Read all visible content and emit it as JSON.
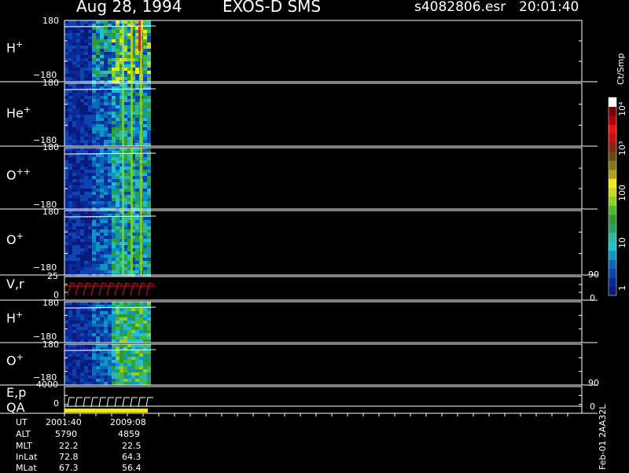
{
  "header": {
    "date": "Aug 28, 1994",
    "instrument": "EXOS-D SMS",
    "file": "s4082806.esr",
    "time": "20:01:40"
  },
  "panels": [
    {
      "key": "h_plus",
      "label": "H",
      "sup": "+",
      "ymax": "180",
      "ymin": "−180"
    },
    {
      "key": "he_plus",
      "label": "He",
      "sup": "+",
      "ymax": "180",
      "ymin": "−180"
    },
    {
      "key": "o_plus_plus",
      "label": "O",
      "sup": "++",
      "ymax": "180",
      "ymin": "−180"
    },
    {
      "key": "o_plus",
      "label": "O",
      "sup": "+",
      "ymax": "180",
      "ymin": "−180"
    },
    {
      "key": "vr",
      "label": "V,r",
      "sup": "",
      "ymax": "25",
      "ymin": "0",
      "rmax": "90",
      "rmin": "0"
    },
    {
      "key": "h_plus_2",
      "label": "H",
      "sup": "+",
      "ymax": "180",
      "ymin": "−180"
    },
    {
      "key": "o_plus_2",
      "label": "O",
      "sup": "+",
      "ymax": "180",
      "ymin": "−180"
    },
    {
      "key": "ep",
      "label": "E,p",
      "label2": "QA",
      "sup": "",
      "ymax": "4000",
      "ymin": "0",
      "rmax": "90",
      "rmin": "0"
    }
  ],
  "colorbar": {
    "unit": "Ct/Smp",
    "ticks": [
      "10⁴",
      "10³",
      "100",
      "10",
      "1"
    ],
    "colors": [
      "#0a1a7a",
      "#0b2a9a",
      "#0c45b0",
      "#0a6ab8",
      "#0d96c2",
      "#20c0d0",
      "#2fb8a0",
      "#2aa060",
      "#2f9a30",
      "#4fb82a",
      "#8ad22a",
      "#c8d820",
      "#f0e818",
      "#b0a020",
      "#807a1a",
      "#6a4a10",
      "#8a2410",
      "#c81010",
      "#f01010",
      "#b00000",
      "#7a0000",
      "#ffffff"
    ]
  },
  "footer": {
    "rows": [
      {
        "label": "UT",
        "v1": "2001:40",
        "v2": "2009:08"
      },
      {
        "label": "ALT",
        "v1": "5790",
        "v2": "4859"
      },
      {
        "label": "MLT",
        "v1": "22.2",
        "v2": "22.5"
      },
      {
        "label": "InLat",
        "v1": "72.8",
        "v2": "64.3"
      },
      {
        "label": "MLat",
        "v1": "67.3",
        "v2": "56.4"
      }
    ],
    "side_note": "Feb-01  2AA32L"
  },
  "chart_data": {
    "type": "heatmap",
    "title": "Aug 28, 1994   EXOS-D SMS",
    "x": [
      "2001:40",
      "2009:08"
    ],
    "series": [
      {
        "name": "H+",
        "ylim": [
          -180,
          180
        ]
      },
      {
        "name": "He+",
        "ylim": [
          -180,
          180
        ]
      },
      {
        "name": "O++",
        "ylim": [
          -180,
          180
        ]
      },
      {
        "name": "O+",
        "ylim": [
          -180,
          180
        ]
      },
      {
        "name": "V,r",
        "ylim": [
          0,
          25
        ]
      },
      {
        "name": "H+",
        "ylim": [
          -180,
          180
        ]
      },
      {
        "name": "O+",
        "ylim": [
          -180,
          180
        ]
      },
      {
        "name": "E,p",
        "ylim": [
          0,
          4000
        ]
      }
    ],
    "colorbar_ticks": [
      1,
      10,
      100,
      1000,
      10000
    ],
    "colorbar_unit": "Ct/Smp"
  }
}
